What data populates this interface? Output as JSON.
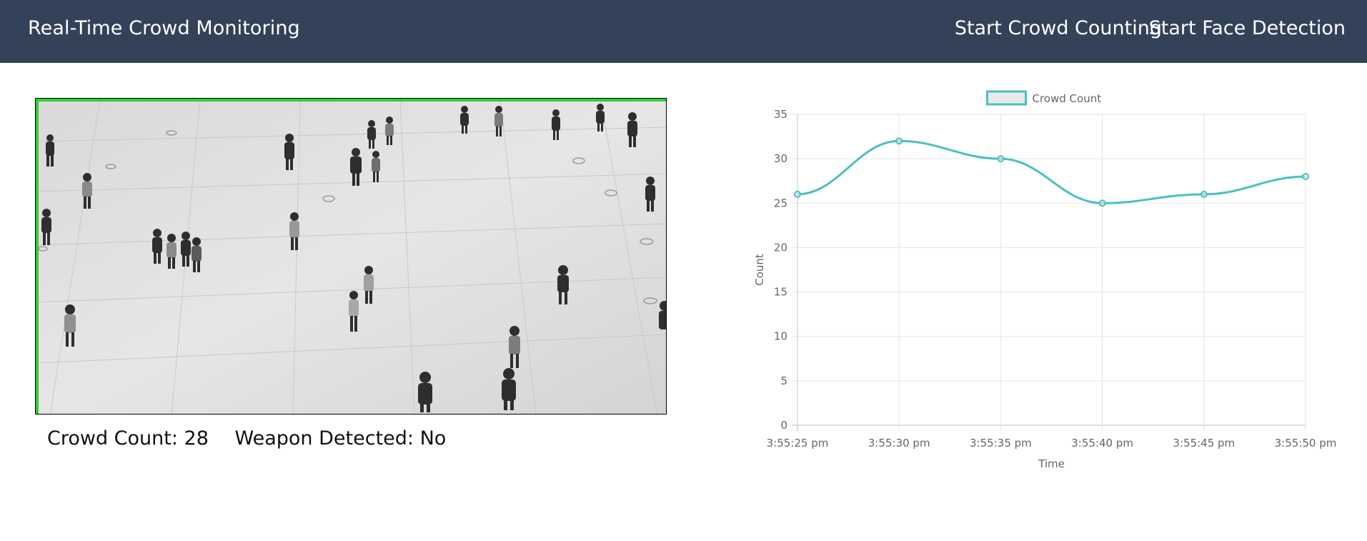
{
  "navbar": {
    "brand": "Real-Time Crowd Monitoring",
    "links": [
      "Start Crowd Counting",
      "Start Face Detection"
    ],
    "background": "#334259"
  },
  "video": {
    "border_accent": "#33cc33"
  },
  "stats": {
    "crowd_count": "Crowd Count: 28",
    "weapon_detected": "Weapon Detected: No"
  },
  "chart_data": {
    "type": "line",
    "legend": "Crowd Count",
    "x": [
      "3:55:25 pm",
      "3:55:30 pm",
      "3:55:35 pm",
      "3:55:40 pm",
      "3:55:45 pm",
      "3:55:50 pm"
    ],
    "series": [
      {
        "name": "Crowd Count",
        "values": [
          26,
          32,
          30,
          25,
          26,
          28
        ],
        "color": "#4bc0c0"
      }
    ],
    "xlabel": "Time",
    "ylabel": "Count",
    "ylim": [
      0,
      35
    ],
    "yticks": [
      0,
      5,
      10,
      15,
      20,
      25,
      30,
      35
    ],
    "grid": true,
    "legend_position": "top"
  }
}
